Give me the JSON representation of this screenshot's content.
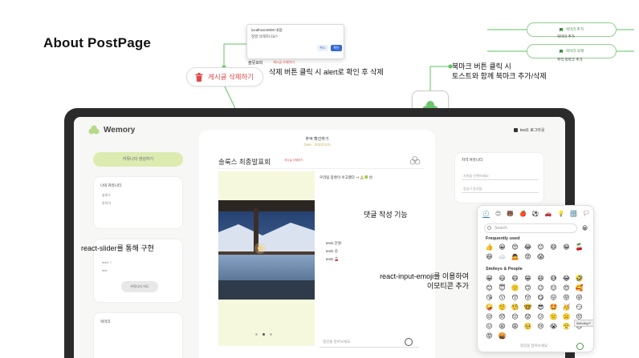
{
  "heading": "About PostPage",
  "alert": {
    "title": "localhost:8000 내용:",
    "message": "정말 삭제하나요?",
    "cancel": "취소",
    "ok": "확인",
    "under_text": "솔뭇포피",
    "under_red": "게시글 삭제하기"
  },
  "delete_button": {
    "label": "게시글 삭제하기"
  },
  "annotations": {
    "delete": "삭제 버튼 클릭 시 alert로 확인 후 삭제",
    "bookmark_line1": "북마크 버튼 클릭 시",
    "bookmark_line2": "토스트와 함께 북마크 추가/삭제",
    "comment": "댓글 작성 기능",
    "slider": "react-slider를 통해 구현",
    "emoji_line1": "react-input-emoji를 이용하여",
    "emoji_line2": "이모티콘 추가"
  },
  "toasts": {
    "add": "북마크 추가",
    "add_sub": "북마크 추가",
    "remove": "북마크 삭제",
    "remove_sub": "추억 북마크 추가"
  },
  "app": {
    "logo": "Wemory",
    "user": "test1 로그아웃",
    "community_button": "커뮤니티 생성하기",
    "my_community": "나의 커뮤니티",
    "my_lines": [
      "솔룩스",
      "잘하자"
    ],
    "map_card_lines": [
      "test1 ?",
      "test"
    ],
    "map_button": "커뮤니티 지도",
    "bookmark_card": "북마크",
    "post_header": "추억 확인하기",
    "post_date": "Date : 2023/11/0",
    "post_title": "솔룩스 최종발표회",
    "mini_delete": "게시글 삭제하기",
    "post_body": "우리팀 중명이 수고했다 ~! 🙏🍀😊",
    "comments": [
      "test1 안녕!",
      "test1 😊",
      "test1 🍒"
    ],
    "comment_placeholder": "댓글을 달아보세요",
    "right_card_title": "지역 커뮤니티",
    "right_select_1": "지역을 선택하세요!",
    "right_select_2": "강남구 음식점"
  },
  "emoji_picker": {
    "categories": [
      "🕘",
      "😊",
      "🐻",
      "🍎",
      "⚽",
      "🚗",
      "💡",
      "🔣",
      "🏳"
    ],
    "search_placeholder": "Search",
    "tone": "😀",
    "frequently_used_title": "Frequently used",
    "frequently_used": [
      "👍",
      "😀",
      "😍",
      "😂",
      "😊",
      "😄",
      "😁",
      "🍒",
      "😆",
      "☁️",
      "🙇",
      "😡",
      "😱"
    ],
    "smileys_title": "Smileys & People",
    "smileys": [
      "😀",
      "😃",
      "😄",
      "😁",
      "😆",
      "😅",
      "😂",
      "🤣",
      "😊",
      "😇",
      "🙂",
      "🙃",
      "😉",
      "😌",
      "😍",
      "🥰",
      "😘",
      "😗",
      "😙",
      "😚",
      "😋",
      "😛",
      "😝",
      "😜",
      "🤪",
      "🤨",
      "🧐",
      "🤓",
      "😎",
      "🤩",
      "🥳",
      "😏",
      "😒",
      "😞",
      "😔",
      "😟",
      "😕",
      "🙁",
      "☹️",
      "😣",
      "😖",
      "😫",
      "😩",
      "🥺",
      "😢",
      "😭",
      "😤",
      "😠",
      "😡",
      "🤬"
    ],
    "tooltip": "Selecting P",
    "input_placeholder": "댓글을 달아보세요"
  },
  "colors": {
    "green_line": "#5ec45e",
    "delete_red": "#e04848",
    "slider_bg": "#f6f8de"
  }
}
